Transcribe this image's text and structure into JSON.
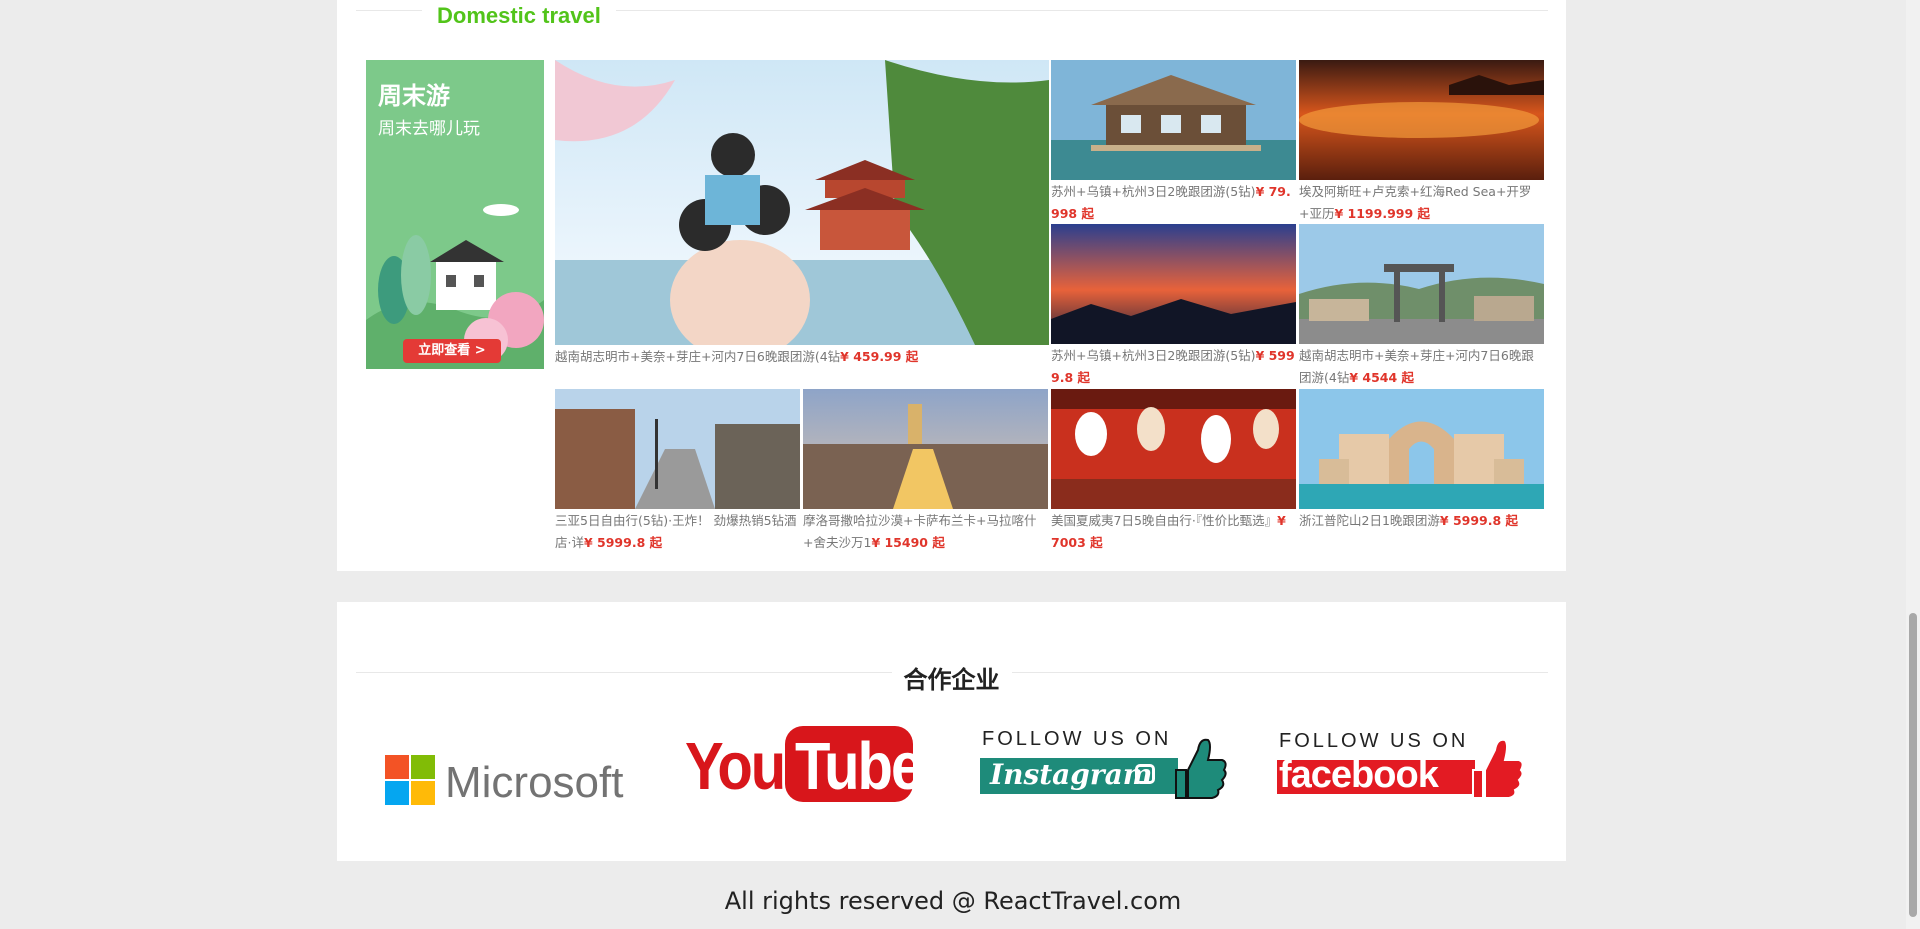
{
  "travel": {
    "heading": "Domestic travel",
    "promo": {
      "title": "周末游",
      "subtitle": "周末去哪儿玩",
      "button": "立即查看 >"
    },
    "tiles": [
      {
        "caption": "越南胡志明市+美奈+芽庄+河内7日6晚跟团游(4钻",
        "price": "¥ 459.99 起"
      },
      {
        "caption": "苏州+乌镇+杭州3日2晚跟团游(5钻)",
        "price": "¥ 79.998 起"
      },
      {
        "caption": "埃及阿斯旺+卢克索+红海Red Sea+开罗+亚历",
        "price": "¥ 1199.999 起"
      },
      {
        "caption": "苏州+乌镇+杭州3日2晚跟团游(5钻)",
        "price": "¥ 5999.8 起"
      },
      {
        "caption": "越南胡志明市+美奈+芽庄+河内7日6晚跟团游(4钻",
        "price": "¥ 4544 起"
      },
      {
        "caption": "三亚5日自由行(5钻)·王炸！ 劲爆热销5钻酒店·详",
        "price": "¥ 5999.8 起"
      },
      {
        "caption": "摩洛哥撒哈拉沙漠+卡萨布兰卡+马拉喀什+舍夫沙万1",
        "price": "¥ 15490 起"
      },
      {
        "caption": "美国夏威夷7日5晚自由行·『性价比甄选』",
        "price": "¥ 7003 起"
      },
      {
        "caption": "浙江普陀山2日1晚跟团游",
        "price": "¥ 5999.8 起"
      }
    ]
  },
  "partners": {
    "heading": "合作企业",
    "microsoft": "Microsoft",
    "youtube_you": "You",
    "youtube_tube": "Tube",
    "follow": "FOLLOW US ON",
    "instagram": "Instagram",
    "facebook": "facebook"
  },
  "footer": {
    "text": "All rights reserved @ ReactTravel.com"
  }
}
